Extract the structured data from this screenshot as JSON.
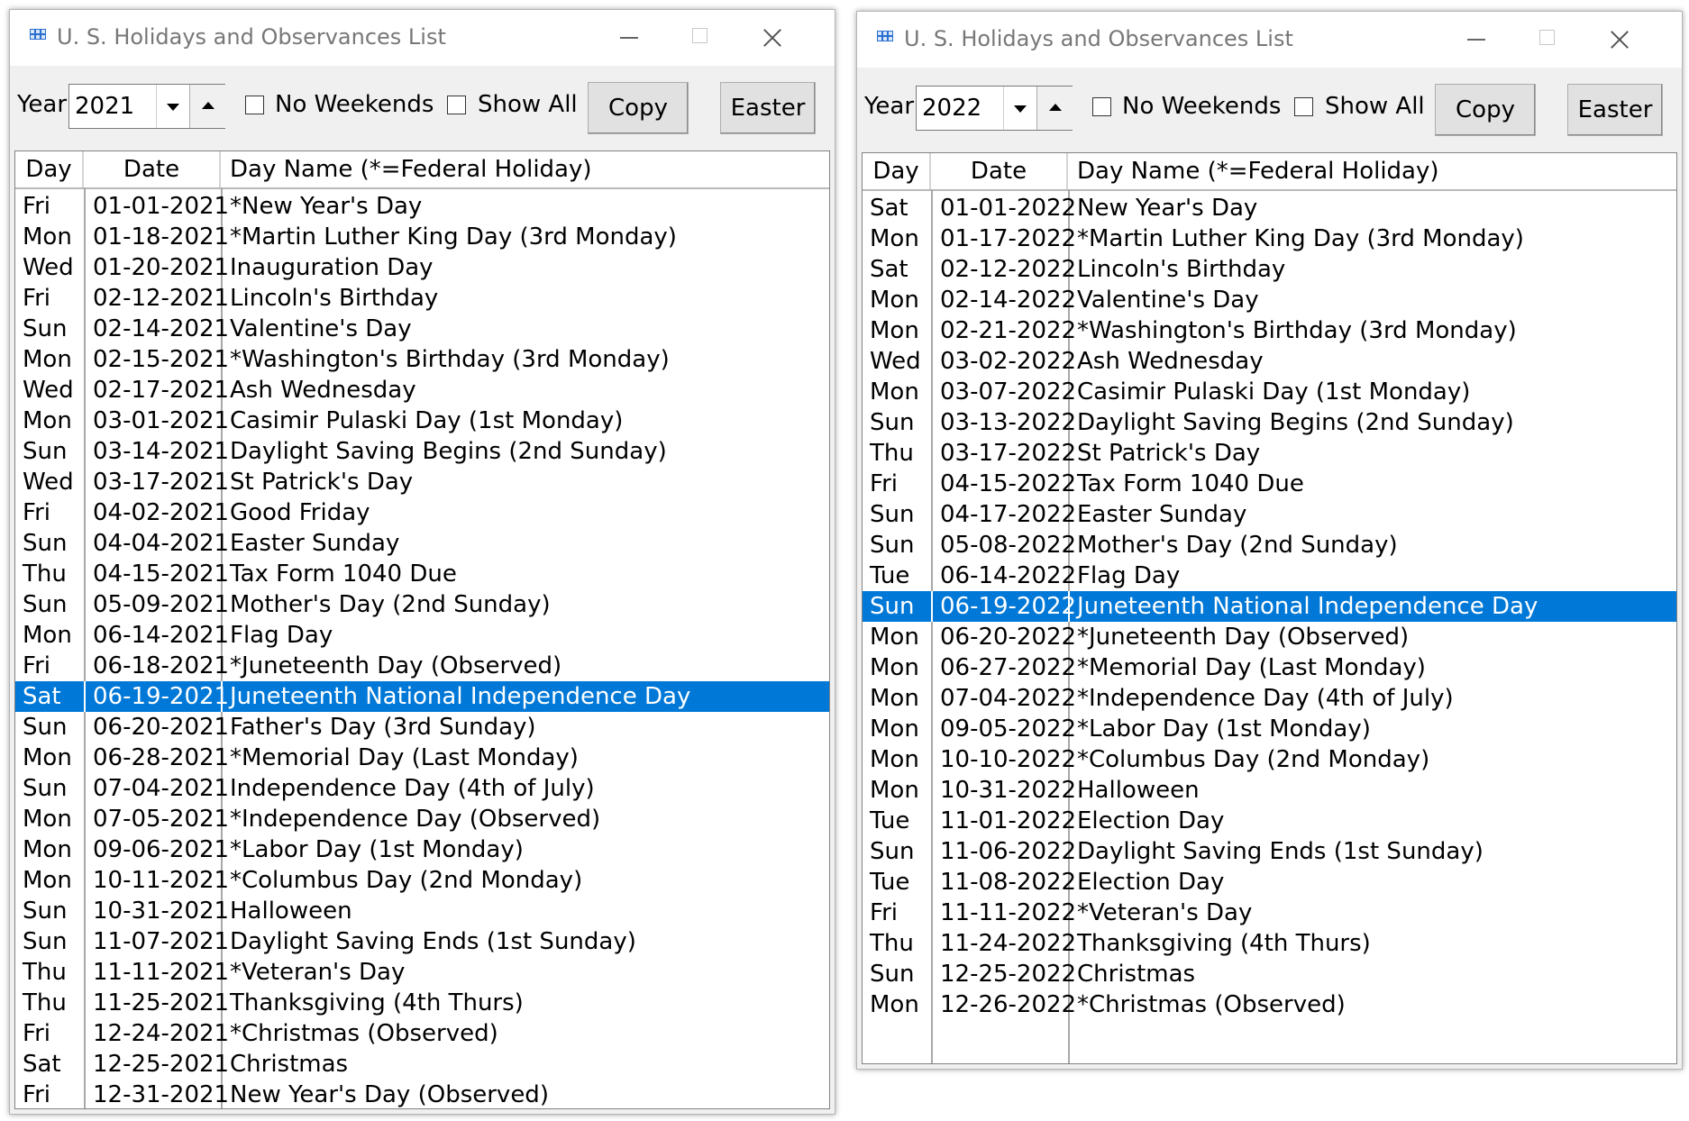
{
  "windows": [
    {
      "title": "U. S. Holidays and Observances List",
      "toolbar": {
        "year_label": "Year",
        "year_value": "2021",
        "no_weekends_label": "No Weekends",
        "no_weekends_checked": false,
        "show_all_label": "Show All",
        "show_all_checked": false,
        "copy_label": "Copy",
        "easter_label": "Easter"
      },
      "columns": {
        "day": "Day",
        "date": "Date",
        "name": "Day Name  (*=Federal Holiday)"
      },
      "selected_index": 16,
      "rows": [
        {
          "day": "Fri",
          "date": "01-01-2021",
          "name": "*New Year's Day"
        },
        {
          "day": "Mon",
          "date": "01-18-2021",
          "name": "*Martin Luther King Day (3rd Monday)"
        },
        {
          "day": "Wed",
          "date": "01-20-2021",
          "name": "Inauguration Day"
        },
        {
          "day": "Fri",
          "date": "02-12-2021",
          "name": "Lincoln's Birthday"
        },
        {
          "day": "Sun",
          "date": "02-14-2021",
          "name": "Valentine's Day"
        },
        {
          "day": "Mon",
          "date": "02-15-2021",
          "name": "*Washington's Birthday (3rd Monday)"
        },
        {
          "day": "Wed",
          "date": "02-17-2021",
          "name": "Ash Wednesday"
        },
        {
          "day": "Mon",
          "date": "03-01-2021",
          "name": "Casimir Pulaski Day (1st Monday)"
        },
        {
          "day": "Sun",
          "date": "03-14-2021",
          "name": "Daylight Saving Begins (2nd Sunday)"
        },
        {
          "day": "Wed",
          "date": "03-17-2021",
          "name": "St Patrick's Day"
        },
        {
          "day": "Fri",
          "date": "04-02-2021",
          "name": "Good Friday"
        },
        {
          "day": "Sun",
          "date": "04-04-2021",
          "name": "Easter Sunday"
        },
        {
          "day": "Thu",
          "date": "04-15-2021",
          "name": "Tax Form 1040 Due"
        },
        {
          "day": "Sun",
          "date": "05-09-2021",
          "name": "Mother's Day (2nd Sunday)"
        },
        {
          "day": "Mon",
          "date": "06-14-2021",
          "name": "Flag Day"
        },
        {
          "day": "Fri",
          "date": "06-18-2021",
          "name": "*Juneteenth Day (Observed)"
        },
        {
          "day": "Sat",
          "date": "06-19-2021",
          "name": "Juneteenth National Independence Day"
        },
        {
          "day": "Sun",
          "date": "06-20-2021",
          "name": "Father's Day (3rd Sunday)"
        },
        {
          "day": "Mon",
          "date": "06-28-2021",
          "name": "*Memorial Day (Last Monday)"
        },
        {
          "day": "Sun",
          "date": "07-04-2021",
          "name": "Independence Day (4th of July)"
        },
        {
          "day": "Mon",
          "date": "07-05-2021",
          "name": "*Independence Day (Observed)"
        },
        {
          "day": "Mon",
          "date": "09-06-2021",
          "name": "*Labor Day (1st Monday)"
        },
        {
          "day": "Mon",
          "date": "10-11-2021",
          "name": "*Columbus Day (2nd Monday)"
        },
        {
          "day": "Sun",
          "date": "10-31-2021",
          "name": "Halloween"
        },
        {
          "day": "Sun",
          "date": "11-07-2021",
          "name": "Daylight Saving Ends (1st Sunday)"
        },
        {
          "day": "Thu",
          "date": "11-11-2021",
          "name": "*Veteran's Day"
        },
        {
          "day": "Thu",
          "date": "11-25-2021",
          "name": "Thanksgiving (4th Thurs)"
        },
        {
          "day": "Fri",
          "date": "12-24-2021",
          "name": "*Christmas (Observed)"
        },
        {
          "day": "Sat",
          "date": "12-25-2021",
          "name": "Christmas"
        },
        {
          "day": "Fri",
          "date": "12-31-2021",
          "name": "New Year's Day (Observed)"
        }
      ]
    },
    {
      "title": "U. S. Holidays and Observances List",
      "toolbar": {
        "year_label": "Year",
        "year_value": "2022",
        "no_weekends_label": "No Weekends",
        "no_weekends_checked": false,
        "show_all_label": "Show All",
        "show_all_checked": false,
        "copy_label": "Copy",
        "easter_label": "Easter"
      },
      "columns": {
        "day": "Day",
        "date": "Date",
        "name": "Day Name  (*=Federal Holiday)"
      },
      "selected_index": 13,
      "rows": [
        {
          "day": "Sat",
          "date": "01-01-2022",
          "name": "New Year's Day"
        },
        {
          "day": "Mon",
          "date": "01-17-2022",
          "name": "*Martin Luther King Day (3rd Monday)"
        },
        {
          "day": "Sat",
          "date": "02-12-2022",
          "name": "Lincoln's Birthday"
        },
        {
          "day": "Mon",
          "date": "02-14-2022",
          "name": "Valentine's Day"
        },
        {
          "day": "Mon",
          "date": "02-21-2022",
          "name": "*Washington's Birthday (3rd Monday)"
        },
        {
          "day": "Wed",
          "date": "03-02-2022",
          "name": "Ash Wednesday"
        },
        {
          "day": "Mon",
          "date": "03-07-2022",
          "name": "Casimir Pulaski Day (1st Monday)"
        },
        {
          "day": "Sun",
          "date": "03-13-2022",
          "name": "Daylight Saving Begins (2nd Sunday)"
        },
        {
          "day": "Thu",
          "date": "03-17-2022",
          "name": "St Patrick's Day"
        },
        {
          "day": "Fri",
          "date": "04-15-2022",
          "name": "Tax Form 1040 Due"
        },
        {
          "day": "Sun",
          "date": "04-17-2022",
          "name": "Easter Sunday"
        },
        {
          "day": "Sun",
          "date": "05-08-2022",
          "name": "Mother's Day (2nd Sunday)"
        },
        {
          "day": "Tue",
          "date": "06-14-2022",
          "name": "Flag Day"
        },
        {
          "day": "Sun",
          "date": "06-19-2022",
          "name": "Juneteenth National Independence Day"
        },
        {
          "day": "Mon",
          "date": "06-20-2022",
          "name": "*Juneteenth Day (Observed)"
        },
        {
          "day": "Mon",
          "date": "06-27-2022",
          "name": "*Memorial Day (Last Monday)"
        },
        {
          "day": "Mon",
          "date": "07-04-2022",
          "name": "*Independence Day (4th of July)"
        },
        {
          "day": "Mon",
          "date": "09-05-2022",
          "name": "*Labor Day (1st Monday)"
        },
        {
          "day": "Mon",
          "date": "10-10-2022",
          "name": "*Columbus Day (2nd Monday)"
        },
        {
          "day": "Mon",
          "date": "10-31-2022",
          "name": "Halloween"
        },
        {
          "day": "Tue",
          "date": "11-01-2022",
          "name": "Election Day"
        },
        {
          "day": "Sun",
          "date": "11-06-2022",
          "name": "Daylight Saving Ends (1st Sunday)"
        },
        {
          "day": "Tue",
          "date": "11-08-2022",
          "name": "Election Day"
        },
        {
          "day": "Fri",
          "date": "11-11-2022",
          "name": "*Veteran's Day"
        },
        {
          "day": "Thu",
          "date": "11-24-2022",
          "name": "Thanksgiving (4th Thurs)"
        },
        {
          "day": "Sun",
          "date": "12-25-2022",
          "name": "Christmas"
        },
        {
          "day": "Mon",
          "date": "12-26-2022",
          "name": "*Christmas (Observed)"
        }
      ]
    }
  ],
  "colors": {
    "selection": "#0078d7",
    "title_text": "#777777",
    "window_bg": "#f0f0f0"
  },
  "icons": {
    "app": "app-grid-icon",
    "minimize": "minimize-icon",
    "maximize": "maximize-icon",
    "close": "close-icon",
    "dropdown": "chevron-down-icon",
    "spin_up": "spin-up-icon"
  }
}
